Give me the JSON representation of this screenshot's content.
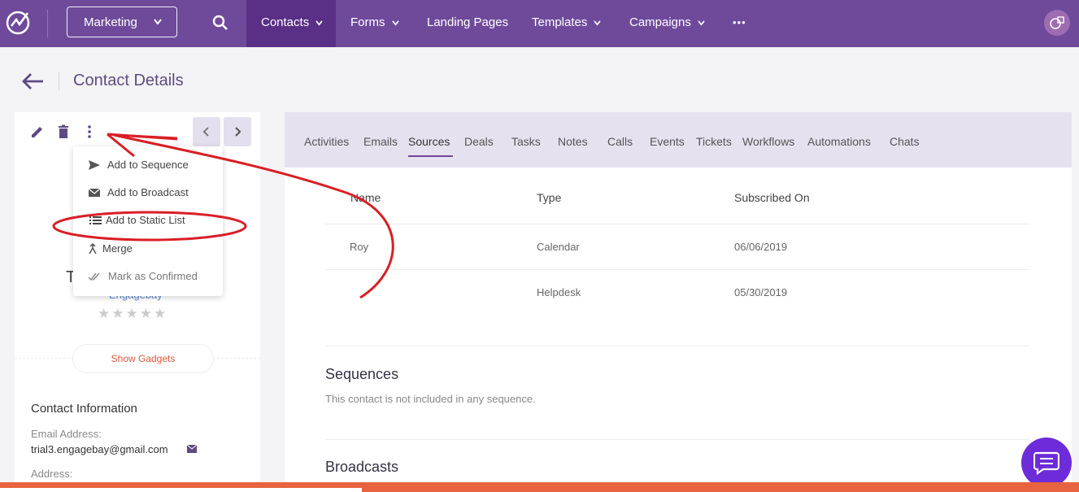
{
  "topnav": {
    "workspace": "Marketing",
    "items": [
      {
        "label": "Contacts",
        "dropdown": true,
        "active": true
      },
      {
        "label": "Forms",
        "dropdown": true
      },
      {
        "label": "Landing Pages",
        "dropdown": false
      },
      {
        "label": "Templates",
        "dropdown": true
      },
      {
        "label": "Campaigns",
        "dropdown": true
      }
    ],
    "more": "•••"
  },
  "header": {
    "title": "Contact Details"
  },
  "dropdown_menu": {
    "items": [
      {
        "label": "Add to Sequence",
        "icon": "send-icon"
      },
      {
        "label": "Add to Broadcast",
        "icon": "envelope-icon"
      },
      {
        "label": "Add to Static List",
        "icon": "list-icon"
      },
      {
        "label": "Merge",
        "icon": "merge-icon"
      },
      {
        "label": "Mark as Confirmed",
        "icon": "double-check-icon"
      }
    ]
  },
  "contact": {
    "name_initial": "T",
    "company": "Engagebay",
    "rating_stars": "★★★★★",
    "rating": 0,
    "show_gadgets": "Show Gadgets",
    "info_heading": "Contact Information",
    "email_label": "Email Address:",
    "email": "trial3.engagebay@gmail.com",
    "address_label": "Address:"
  },
  "tabs": [
    "Activities",
    "Emails",
    "Sources",
    "Deals",
    "Tasks",
    "Notes",
    "Calls",
    "Events",
    "Tickets",
    "Workflows",
    "Automations",
    "Chats"
  ],
  "active_tab": "Sources",
  "sources_table": {
    "headers": [
      "Name",
      "Type",
      "Subscribed On"
    ],
    "rows": [
      {
        "name": "Roy",
        "type": "Calendar",
        "subscribed_on": "06/06/2019"
      },
      {
        "name": "",
        "type": "Helpdesk",
        "subscribed_on": "05/30/2019"
      }
    ]
  },
  "sequences": {
    "title": "Sequences",
    "text": "This contact is not included in any sequence."
  },
  "broadcasts": {
    "title": "Broadcasts"
  },
  "colors": {
    "nav": "#6f4a9b",
    "nav_active": "#5a2f86",
    "accent": "#e0583c",
    "annotation": "#d91f26",
    "chat": "#6d2bd9"
  }
}
